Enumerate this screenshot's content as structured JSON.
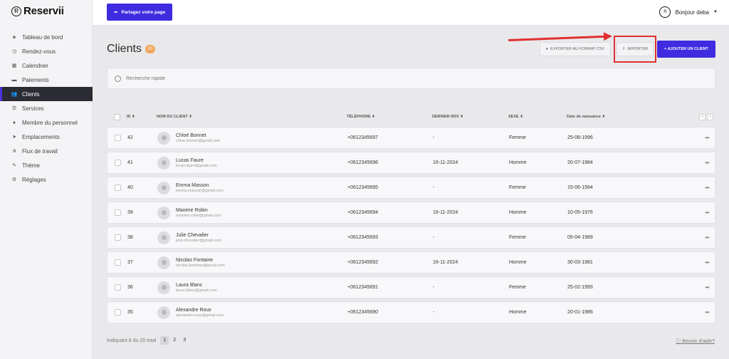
{
  "brand": {
    "name": "Reservii",
    "mark": "R"
  },
  "sidebar": {
    "items": [
      {
        "label": "Tableau de bord",
        "icon": "box-icon",
        "glyph": "◈"
      },
      {
        "label": "Rendez-vous",
        "icon": "clock-icon",
        "glyph": "◷"
      },
      {
        "label": "Calendrier",
        "icon": "calendar-icon",
        "glyph": "▦"
      },
      {
        "label": "Paiements",
        "icon": "wallet-icon",
        "glyph": "▬"
      },
      {
        "label": "Clients",
        "icon": "users-icon",
        "glyph": "👥"
      },
      {
        "label": "Services",
        "icon": "list-icon",
        "glyph": "☰"
      },
      {
        "label": "Membre du personnel",
        "icon": "user-icon",
        "glyph": "●"
      },
      {
        "label": "Emplacements",
        "icon": "location-arrow-icon",
        "glyph": "➤"
      },
      {
        "label": "Flux de travail",
        "icon": "workflow-icon",
        "glyph": "⋔"
      },
      {
        "label": "Thème",
        "icon": "brush-icon",
        "glyph": "✎"
      },
      {
        "label": "Réglages",
        "icon": "gear-icon",
        "glyph": "⚙"
      }
    ],
    "active_index": 4
  },
  "topbar": {
    "share_label": "Partagez votre page",
    "greeting": "Bonjour deba",
    "avatar_label": "R"
  },
  "page": {
    "title": "Clients",
    "count_badge": "20",
    "export_label": "EXPORTER AU FORMAT CSV",
    "import_label": "IMPORTER",
    "add_label": "+ AJOUTER UN CLIENT"
  },
  "search": {
    "placeholder": "Recherche rapide"
  },
  "table": {
    "headers": {
      "id": "ID ⬍",
      "name": "NOM DU CLIENT ⬍",
      "phone": "TÉLÉPHONE ⬍",
      "rdv": "DERNIER RDV ⬍",
      "sexe": "SEXE ⬍",
      "dob": "Date de naissance ⬍"
    },
    "rows": [
      {
        "id": "42",
        "name": "Chloé Bonnet",
        "email": "chloe.bonnet@gmail.com",
        "phone": "+0612345697",
        "rdv": "-",
        "sexe": "Femme",
        "dob": "25-08-1996"
      },
      {
        "id": "41",
        "name": "Lucas Faure",
        "email": "lucas.faure@gmail.com",
        "phone": "+0612345696",
        "rdv": "16-11-2024",
        "sexe": "Homme",
        "dob": "20-07-1984"
      },
      {
        "id": "40",
        "name": "Emma Masson",
        "email": "emma.masson@gmail.com",
        "phone": "+0612345695",
        "rdv": "-",
        "sexe": "Femme",
        "dob": "15-06-1994"
      },
      {
        "id": "39",
        "name": "Maxime Robin",
        "email": "maxime.robin@gmail.com",
        "phone": "+0612345694",
        "rdv": "16-11-2024",
        "sexe": "Homme",
        "dob": "10-05-1976"
      },
      {
        "id": "38",
        "name": "Julie Chevalier",
        "email": "julie.chevalier@gmail.com",
        "phone": "+0612345693",
        "rdv": "-",
        "sexe": "Femme",
        "dob": "05-04-1989"
      },
      {
        "id": "37",
        "name": "Nicolas Fontaine",
        "email": "nicolas.fontaine@gmail.com",
        "phone": "+0612345692",
        "rdv": "16-11-2024",
        "sexe": "Homme",
        "dob": "30-03-1981"
      },
      {
        "id": "36",
        "name": "Laura Blanc",
        "email": "laura.blanc@gmail.com",
        "phone": "+0612345691",
        "rdv": "-",
        "sexe": "Femme",
        "dob": "25-02-1993"
      },
      {
        "id": "35",
        "name": "Alexandre Roux",
        "email": "alexandre.roux@gmail.com",
        "phone": "+0612345690",
        "rdv": "-",
        "sexe": "Homme",
        "dob": "20-01-1986"
      }
    ]
  },
  "footer": {
    "info": "Indiquant 8 du 20 total",
    "pages": [
      "1",
      "2",
      "3"
    ],
    "active_page": 0,
    "help": "Besoin d'aide?"
  },
  "colors": {
    "accent": "#3f2be0",
    "highlight": "#e03030",
    "badge": "#f2a65a",
    "sidebar_active": "#2b2b33"
  }
}
